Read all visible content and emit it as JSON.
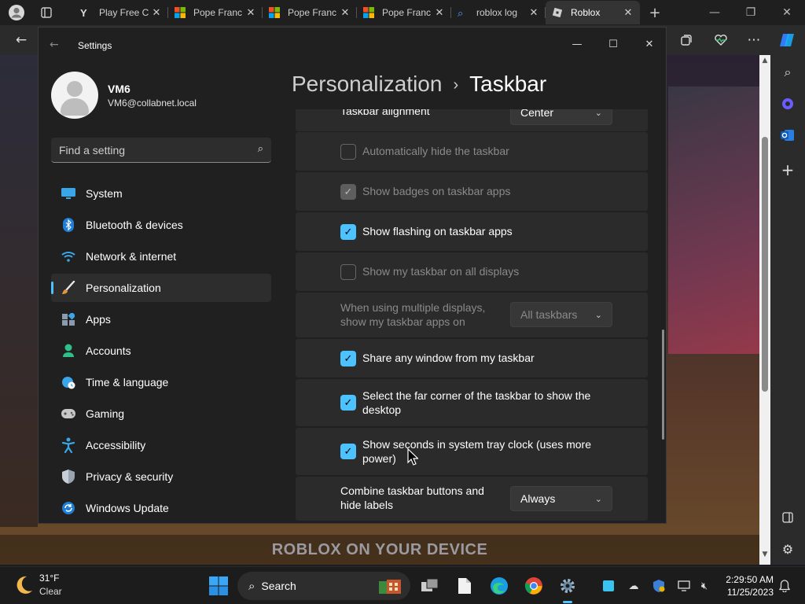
{
  "browser": {
    "tabs": [
      {
        "label": "Play Free C",
        "icon": "y-icon"
      },
      {
        "label": "Pope Franc",
        "icon": "microsoft-icon"
      },
      {
        "label": "Pope Franc",
        "icon": "microsoft-icon"
      },
      {
        "label": "Pope Franc",
        "icon": "microsoft-icon"
      },
      {
        "label": "roblox log",
        "icon": "search-icon"
      },
      {
        "label": "Roblox",
        "icon": "roblox-icon",
        "active": true
      }
    ],
    "page_footer_text": "ROBLOX ON YOUR DEVICE"
  },
  "settings": {
    "window_title": "Settings",
    "user": {
      "name": "VM6",
      "email": "VM6@collabnet.local"
    },
    "search_placeholder": "Find a setting",
    "nav": [
      {
        "label": "System",
        "icon": "monitor-icon"
      },
      {
        "label": "Bluetooth & devices",
        "icon": "bluetooth-icon"
      },
      {
        "label": "Network & internet",
        "icon": "wifi-icon"
      },
      {
        "label": "Personalization",
        "icon": "brush-icon",
        "active": true
      },
      {
        "label": "Apps",
        "icon": "apps-icon"
      },
      {
        "label": "Accounts",
        "icon": "person-icon"
      },
      {
        "label": "Time & language",
        "icon": "globe-clock-icon"
      },
      {
        "label": "Gaming",
        "icon": "gamepad-icon"
      },
      {
        "label": "Accessibility",
        "icon": "accessibility-icon"
      },
      {
        "label": "Privacy & security",
        "icon": "shield-icon"
      },
      {
        "label": "Windows Update",
        "icon": "update-icon"
      }
    ],
    "breadcrumb": {
      "parent": "Personalization",
      "current": "Taskbar"
    },
    "options": {
      "alignment": {
        "label": "Taskbar alignment",
        "value": "Center"
      },
      "auto_hide": {
        "label": "Automatically hide the taskbar",
        "checked": false,
        "enabled": false
      },
      "badges": {
        "label": "Show badges on taskbar apps",
        "checked": true,
        "enabled": false
      },
      "flashing": {
        "label": "Show flashing on taskbar apps",
        "checked": true,
        "enabled": true
      },
      "all_displays": {
        "label": "Show my taskbar on all displays",
        "checked": false,
        "enabled": false
      },
      "multi_display": {
        "label_line1": "When using multiple displays,",
        "label_line2": "show my taskbar apps on",
        "value": "All taskbars",
        "enabled": false
      },
      "share_window": {
        "label": "Share any window from my taskbar",
        "checked": true,
        "enabled": true
      },
      "far_corner": {
        "label_line1": "Select the far corner of the taskbar to show the",
        "label_line2": "desktop",
        "checked": true,
        "enabled": true
      },
      "show_seconds": {
        "label_line1": "Show seconds in system tray clock (uses more",
        "label_line2": "power)",
        "checked": true,
        "enabled": true
      },
      "combine": {
        "label_line1": "Combine taskbar buttons and",
        "label_line2": "hide labels",
        "value": "Always"
      }
    }
  },
  "taskbar": {
    "weather": {
      "temp": "31°F",
      "desc": "Clear"
    },
    "search_label": "Search",
    "clock": {
      "time": "2:29:50 AM",
      "date": "11/25/2023"
    }
  },
  "colors": {
    "accent": "#4cc2ff",
    "settings_bg": "#202020",
    "card_bg": "#2b2b2b"
  }
}
